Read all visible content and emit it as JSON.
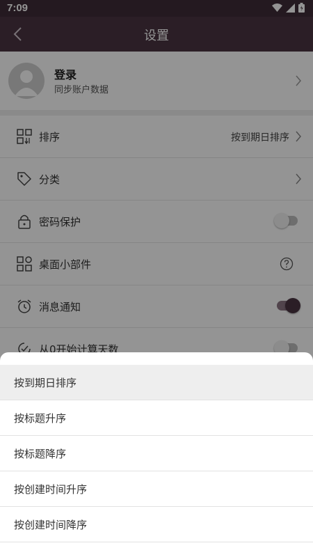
{
  "status_bar": {
    "time": "7:09",
    "icons": [
      "wifi-icon",
      "signal-icon",
      "battery-icon"
    ]
  },
  "app_bar": {
    "title": "设置",
    "back_icon": "back-arrow-icon"
  },
  "login": {
    "title": "登录",
    "subtitle": "同步账户数据"
  },
  "settings": {
    "sort": {
      "label": "排序",
      "value": "按到期日排序",
      "icon": "sort-grid-icon"
    },
    "category": {
      "label": "分类",
      "icon": "tag-icon"
    },
    "password": {
      "label": "密码保护",
      "icon": "lock-icon",
      "enabled": false
    },
    "widget": {
      "label": "桌面小部件",
      "icon": "widget-icon"
    },
    "notify": {
      "label": "消息通知",
      "icon": "alarm-clock-icon",
      "enabled": true
    },
    "count_zero": {
      "label": "从0开始计算天数",
      "icon": "check-clock-icon",
      "enabled": false
    }
  },
  "sort_sheet": {
    "selected_index": 0,
    "options": [
      "按到期日排序",
      "按标题升序",
      "按标题降序",
      "按创建时间升序",
      "按创建时间降序"
    ]
  },
  "colors": {
    "app_bar": "#4a3443",
    "status_bar": "#3e2c38",
    "accent": "#4a3443"
  }
}
